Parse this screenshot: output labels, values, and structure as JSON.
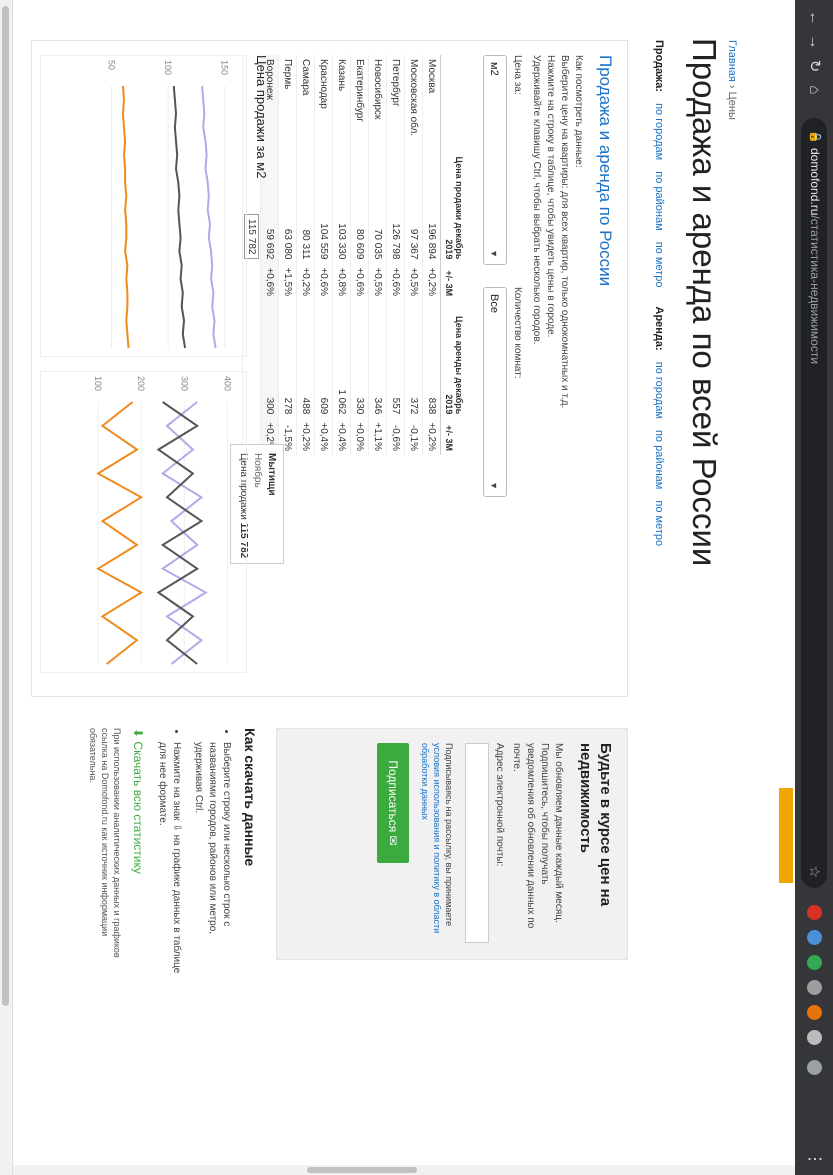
{
  "browser": {
    "url_domain": "domofond.ru",
    "url_path": "/статистика-недвижимости"
  },
  "breadcrumb": {
    "home": "Главная",
    "sep": " › ",
    "current": "Цены"
  },
  "page": {
    "title": "Продажа и аренда по всей России"
  },
  "subnav": {
    "sale_label": "Продажа:",
    "sale_links": [
      "по городам",
      "по районам",
      "по метро"
    ],
    "rent_label": "Аренда:",
    "rent_links": [
      "по городам",
      "по районам",
      "по метро"
    ]
  },
  "card": {
    "title": "Продажа и аренда по России",
    "desc_lines": [
      "Как посмотреть данные:",
      "Выберите цену на квартиры: для всех квартир, только однокомнатных и т.д.",
      "Нажмите на строку в таблице, чтобы увидеть цены в городе.",
      "Удерживайте клавишу Ctrl, чтобы выбрать несколько городов."
    ],
    "price_label": "Цена за:",
    "price_value": "м2",
    "rooms_label": "Количество комнат:",
    "rooms_value": "Все"
  },
  "table": {
    "headers": [
      "Цена продажи декабрь 2019",
      "+/- 3М",
      "Цена аренды декабрь 2019",
      "+/- 3М"
    ],
    "rows": [
      {
        "city": "Москва",
        "sale": "196 894",
        "sale_chg": "+0,2%",
        "rent": "838",
        "rent_chg": "+0,2%"
      },
      {
        "city": "Московская обл.",
        "sale": "97 367",
        "sale_chg": "+0,5%",
        "rent": "372",
        "rent_chg": "-0,1%"
      },
      {
        "city": "Петербург",
        "sale": "126 798",
        "sale_chg": "+0,6%",
        "rent": "557",
        "rent_chg": "-0,6%"
      },
      {
        "city": "Новосибирск",
        "sale": "70 035",
        "sale_chg": "+0,5%",
        "rent": "346",
        "rent_chg": "+1,1%"
      },
      {
        "city": "Екатеринбург",
        "sale": "80 609",
        "sale_chg": "+0,6%",
        "rent": "330",
        "rent_chg": "+0,0%"
      },
      {
        "city": "Казань",
        "sale": "103 330",
        "sale_chg": "+0,8%",
        "rent": "1 062",
        "rent_chg": "+0,4%"
      },
      {
        "city": "Краснодар",
        "sale": "104 559",
        "sale_chg": "+0,6%",
        "rent": "609",
        "rent_chg": "+0,4%"
      },
      {
        "city": "Самара",
        "sale": "80 311",
        "sale_chg": "+0,2%",
        "rent": "488",
        "rent_chg": "+0,2%"
      },
      {
        "city": "Пермь",
        "sale": "63 080",
        "sale_chg": "+1,5%",
        "rent": "278",
        "rent_chg": "-1,5%"
      },
      {
        "city": "Воронеж",
        "sale": "59 692",
        "sale_chg": "+0,6%",
        "rent": "300",
        "rent_chg": "+0,2%"
      }
    ],
    "selected_value": "115 782"
  },
  "tooltip": {
    "title": "Мытищи",
    "period": "Ноябрь",
    "label": "Цена продажи",
    "value": "115 782"
  },
  "chart_section": {
    "title": "Цена продажи за м2"
  },
  "chart_data": [
    {
      "type": "line",
      "title": "Цена продажи за м2",
      "y_ticks": [
        "150",
        "100",
        "50"
      ],
      "series": [
        {
          "values": [
            130,
            131,
            132,
            131,
            133,
            134,
            133,
            135,
            136,
            135,
            137,
            136,
            138,
            139,
            138,
            140,
            139,
            141,
            140,
            142
          ]
        },
        {
          "values": [
            105,
            106,
            107,
            106,
            107,
            108,
            107,
            109,
            110,
            109,
            110,
            111,
            110,
            112,
            111,
            113,
            112,
            114,
            113,
            115
          ]
        },
        {
          "values": [
            60,
            61,
            60,
            61,
            62,
            61,
            62,
            62,
            63,
            62,
            63,
            63,
            62,
            64,
            63,
            64,
            64,
            63,
            64,
            65
          ]
        }
      ],
      "colors": [
        "#b6a7e8",
        "#555555",
        "#f08a1c"
      ],
      "ylim": [
        0,
        160
      ]
    },
    {
      "type": "line",
      "y_ticks": [
        "400",
        "300",
        "200",
        "100"
      ],
      "series": [
        {
          "values": [
            330,
            260,
            320,
            250,
            340,
            270,
            330,
            250,
            350,
            260,
            340,
            270
          ]
        },
        {
          "values": [
            250,
            330,
            240,
            320,
            260,
            340,
            250,
            330,
            240,
            320,
            260,
            330
          ]
        },
        {
          "values": [
            180,
            110,
            190,
            100,
            200,
            110,
            190,
            100,
            200,
            110,
            190,
            120
          ]
        }
      ],
      "colors": [
        "#b6a7e8",
        "#555555",
        "#f08a1c"
      ],
      "ylim": [
        0,
        420
      ]
    }
  ],
  "sidebar": {
    "title": "Будьте в курсе цен на недвижимость",
    "text": "Мы обновляем данные каждый месяц. Подпишитесь, чтобы получать уведомления об обновлении данных по почте.",
    "email_label": "Адрес электронной почты:",
    "agree_text": "Подписываясь на рассылку, вы принимаете",
    "agree_link": "условия использования и политику в области обработки данных",
    "subscribe_button": "Подписаться ✉"
  },
  "download": {
    "title": "Как скачать данные",
    "items": [
      "Выберите строку или несколько строк с названиями городов, районов или метро, удерживая Ctrl.",
      "Нажмите на знак ⇩ на графике данных в таблице для нее формате."
    ],
    "link": "Скачать всю статистику",
    "note": "При использовании аналитических данных и графиков ссылка на Domofond.ru как источник информации обязательна."
  }
}
